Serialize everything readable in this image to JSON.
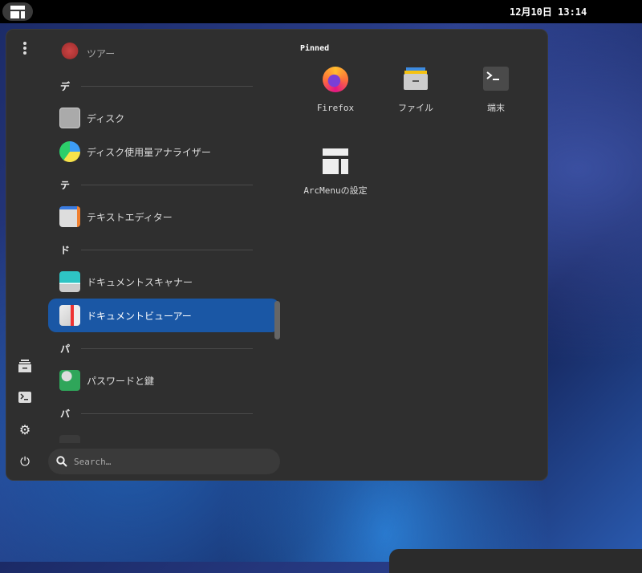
{
  "topbar": {
    "clock": "12月10日 13:14"
  },
  "list": {
    "items": [
      {
        "label": "ツアー"
      },
      {
        "header": "デ"
      },
      {
        "label": "ディスク"
      },
      {
        "label": "ディスク使用量アナライザー"
      },
      {
        "header": "テ"
      },
      {
        "label": "テキストエディター"
      },
      {
        "header": "ド"
      },
      {
        "label": "ドキュメントスキャナー"
      },
      {
        "label": "ドキュメントビューアー"
      },
      {
        "header": "パ"
      },
      {
        "label": "パスワードと鍵"
      },
      {
        "header": "バ"
      }
    ]
  },
  "search": {
    "placeholder": "Search…"
  },
  "pinned": {
    "title": "Pinned",
    "apps": [
      {
        "label": "Firefox"
      },
      {
        "label": "ファイル"
      },
      {
        "label": "端末"
      },
      {
        "label": "ArcMenuの設定"
      }
    ]
  },
  "colors": {
    "selected": "#1a57a5",
    "panel": "#2f2f2f"
  }
}
